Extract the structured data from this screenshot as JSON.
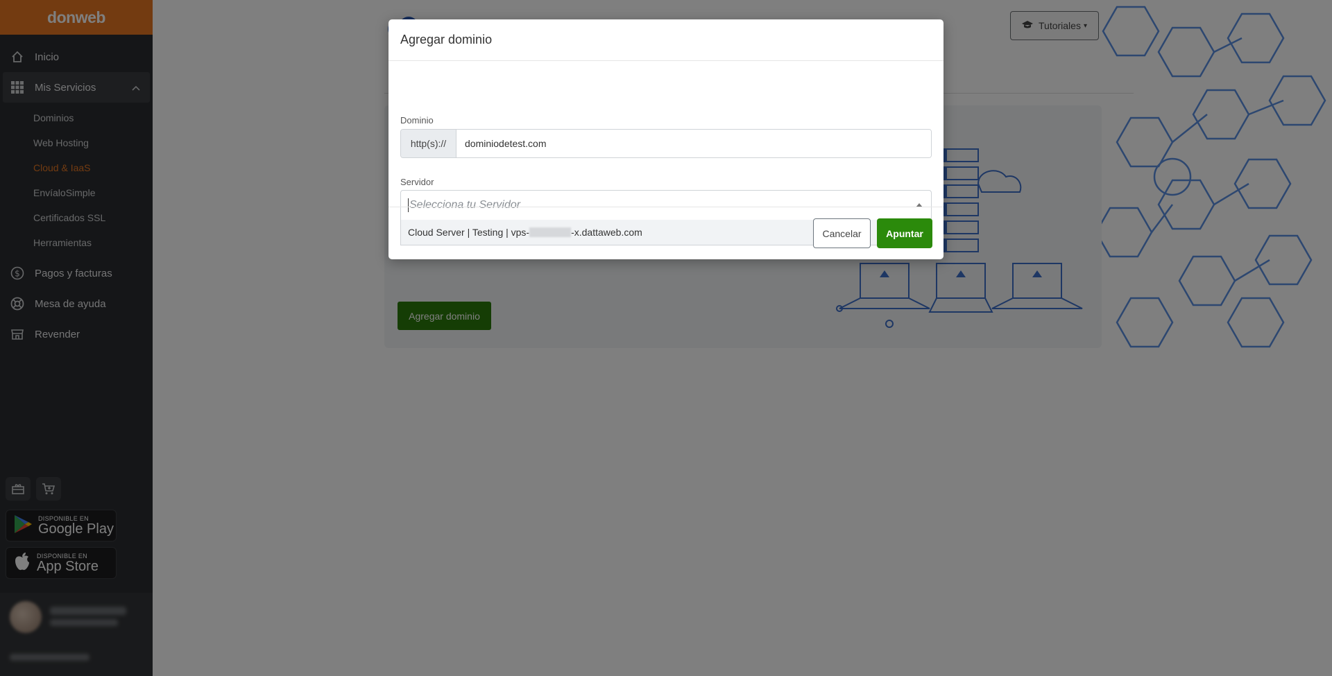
{
  "sidebar": {
    "brand": "donweb",
    "items": [
      {
        "label": "Inicio",
        "icon": "home-icon"
      },
      {
        "label": "Mis Servicios",
        "icon": "grid-icon"
      }
    ],
    "subitems": [
      {
        "label": "Dominios"
      },
      {
        "label": "Web Hosting"
      },
      {
        "label": "Cloud & IaaS",
        "current": true
      },
      {
        "label": "EnvíaloSimple"
      },
      {
        "label": "Certificados SSL"
      },
      {
        "label": "Herramientas"
      }
    ],
    "lower_items": [
      {
        "label": "Pagos y facturas",
        "icon": "dollar-circle-icon"
      },
      {
        "label": "Mesa de ayuda",
        "icon": "lifebuoy-icon"
      },
      {
        "label": "Revender",
        "icon": "store-icon"
      }
    ],
    "google_play": {
      "small": "DISPONIBLE EN",
      "big": "Google Play"
    },
    "app_store": {
      "small": "DISPONIBLE EN",
      "big": "App Store"
    }
  },
  "main": {
    "tutoriales_label": "Tutoriales",
    "add_domain_button": "Agregar dominio"
  },
  "modal": {
    "title": "Agregar dominio",
    "domain_label": "Dominio",
    "domain_prefix": "http(s)://",
    "domain_value": "dominiodetest.com",
    "server_label": "Servidor",
    "server_placeholder": "Selecciona tu Servidor",
    "server_option_prefix": "Cloud Server | Testing | vps-",
    "server_option_suffix": "-x.dattaweb.com",
    "cancel_label": "Cancelar",
    "submit_label": "Apuntar"
  },
  "colors": {
    "brand_orange": "#e67722",
    "sidebar_bg": "#2b2d30",
    "primary_green": "#2b8a0b"
  }
}
